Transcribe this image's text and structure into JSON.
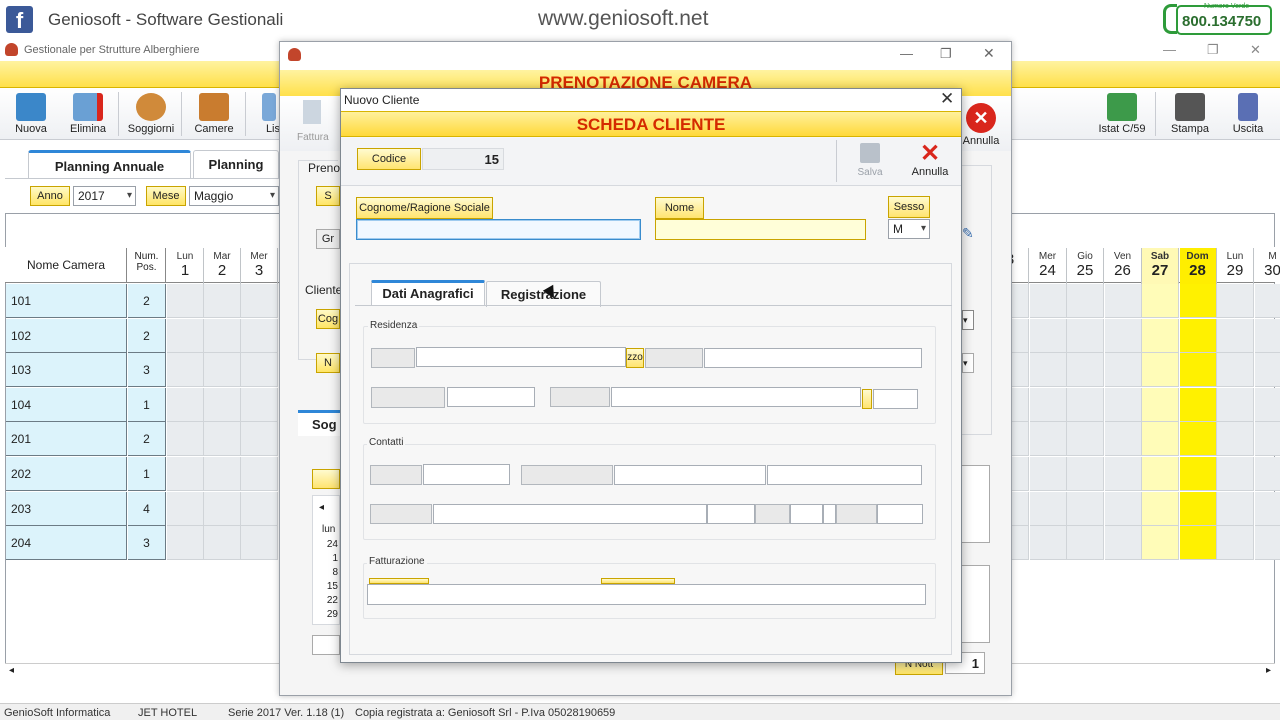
{
  "branding": {
    "fb_glyph": "f",
    "title": "Geniosoft - Software Gestionali",
    "url": "www.geniosoft.net",
    "phone_label": "Numero Verde",
    "phone": "800.134750"
  },
  "app": {
    "title": "Gestionale per Strutture Alberghiere",
    "win_min": "—",
    "win_max": "❐",
    "win_close": "✕"
  },
  "toolbar": {
    "nuova": "Nuova",
    "elimina": "Elimina",
    "soggiorni": "Soggiorni",
    "camere": "Camere",
    "listini": "Lis",
    "istat": "Istat C/59",
    "stampa": "Stampa",
    "uscita": "Uscita"
  },
  "tabs": {
    "planning_annuale": "Planning Annuale",
    "planning": "Planning"
  },
  "filters": {
    "anno_label": "Anno",
    "anno_value": "2017",
    "mese_label": "Mese",
    "mese_value": "Maggio"
  },
  "grid": {
    "col_nome": "Nome Camera",
    "col_pos": "Num.\nPos.",
    "left_days": [
      {
        "dn": "Lun",
        "dd": "1"
      },
      {
        "dn": "Mar",
        "dd": "2"
      },
      {
        "dn": "Mer",
        "dd": "3"
      }
    ],
    "right_days": [
      {
        "dn": "",
        "dd": "3"
      },
      {
        "dn": "Mer",
        "dd": "24"
      },
      {
        "dn": "Gio",
        "dd": "25"
      },
      {
        "dn": "Ven",
        "dd": "26"
      },
      {
        "dn": "Sab",
        "dd": "27"
      },
      {
        "dn": "Dom",
        "dd": "28"
      },
      {
        "dn": "Lun",
        "dd": "29"
      },
      {
        "dn": "M",
        "dd": "30"
      }
    ],
    "rooms": [
      {
        "name": "101",
        "pos": "2"
      },
      {
        "name": "102",
        "pos": "2"
      },
      {
        "name": "103",
        "pos": "3"
      },
      {
        "name": "104",
        "pos": "1"
      },
      {
        "name": "201",
        "pos": "2"
      },
      {
        "name": "202",
        "pos": "1"
      },
      {
        "name": "203",
        "pos": "4"
      },
      {
        "name": "204",
        "pos": "3"
      }
    ]
  },
  "mid_dialog": {
    "banner": "PRENOTAZIONE CAMERA",
    "fattura": "Fattura",
    "annulla": "Annulla",
    "prenotazione": "Preno",
    "cliente": "Cliente",
    "soggiorno": "Sog",
    "btn_s": "S",
    "btn_gr": "Gr",
    "btn_cog": "Cog",
    "btn_n": "N",
    "cal_nav": "◂",
    "cal_lun": "lun",
    "cal_days": [
      "24",
      "1",
      "8",
      "15",
      "22",
      "29"
    ],
    "next_label": "N Nott",
    "next_value": "1"
  },
  "dialog": {
    "title": "Nuovo Cliente",
    "close": "✕",
    "banner": "SCHEDA CLIENTE",
    "codice_label": "Codice",
    "codice_value": "15",
    "salva": "Salva",
    "annulla": "Annulla",
    "cognome_label": "Cognome/Ragione Sociale",
    "nome_label": "Nome",
    "sesso_label": "Sesso",
    "sesso_value": "M",
    "tab_anagrafici": "Dati Anagrafici",
    "tab_registrazione": "Registrazione",
    "residenza": "Residenza",
    "residenza_fragment": "zzo",
    "contatti": "Contatti",
    "fatturazione": "Fatturazione"
  },
  "status": {
    "company": "GenioSoft Informatica",
    "product": "JET HOTEL",
    "version": "Serie 2017 Ver. 1.18 (1)",
    "license": "Copia registrata a: Geniosoft Srl  - P.Iva 05028190659"
  }
}
